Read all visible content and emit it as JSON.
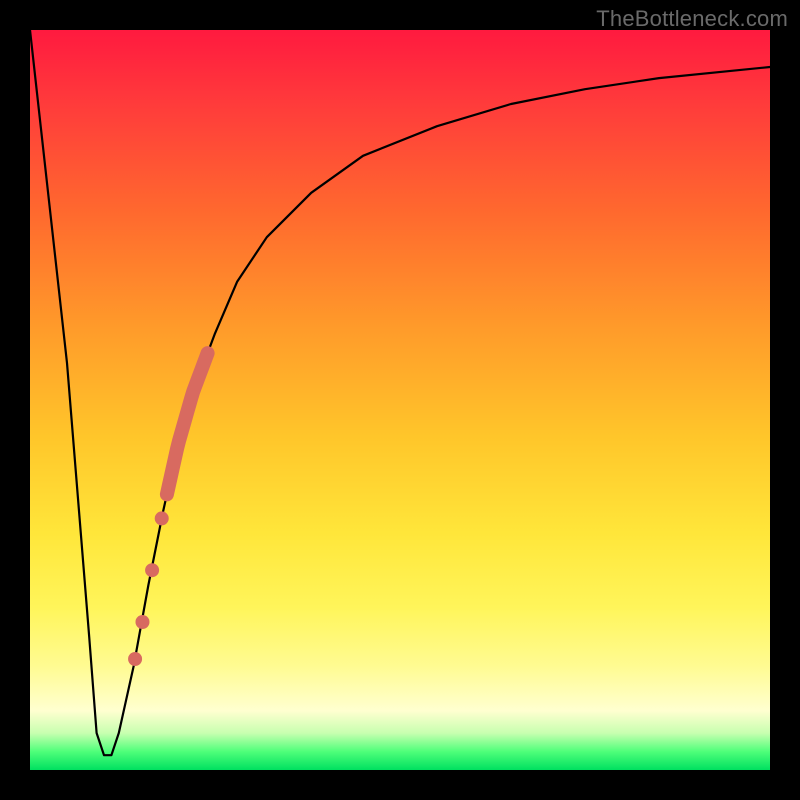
{
  "watermark": "TheBottleneck.com",
  "colors": {
    "dot": "#d86a60",
    "thick_segment": "#d86a60",
    "curve": "#000000"
  },
  "chart_data": {
    "type": "line",
    "title": "",
    "xlabel": "",
    "ylabel": "",
    "xlim": [
      0,
      100
    ],
    "ylim": [
      0,
      100
    ],
    "grid": false,
    "legend": null,
    "series": [
      {
        "name": "bottleneck-curve",
        "x": [
          0,
          5,
          8,
          9,
          10,
          11,
          12,
          14,
          16,
          18,
          20,
          22,
          25,
          28,
          32,
          38,
          45,
          55,
          65,
          75,
          85,
          95,
          100
        ],
        "y": [
          100,
          55,
          18,
          5,
          2,
          2,
          5,
          14,
          25,
          35,
          44,
          51,
          59,
          66,
          72,
          78,
          83,
          87,
          90,
          92,
          93.5,
          94.5,
          95
        ]
      }
    ],
    "highlight_segment": {
      "series": "bottleneck-curve",
      "x_start": 18.5,
      "x_end": 24.0,
      "note": "thick salmon stroke along curve"
    },
    "highlight_points": [
      {
        "x": 17.8,
        "y": 34
      },
      {
        "x": 16.5,
        "y": 27
      },
      {
        "x": 15.2,
        "y": 20
      },
      {
        "x": 14.2,
        "y": 15
      }
    ],
    "background_gradient": {
      "direction": "top-to-bottom",
      "stops": [
        {
          "pos": 0.0,
          "color": "#ff1a3f"
        },
        {
          "pos": 0.25,
          "color": "#ff6a2e"
        },
        {
          "pos": 0.55,
          "color": "#ffc62a"
        },
        {
          "pos": 0.78,
          "color": "#fff55a"
        },
        {
          "pos": 0.92,
          "color": "#ffffd0"
        },
        {
          "pos": 1.0,
          "color": "#00e060"
        }
      ]
    }
  }
}
